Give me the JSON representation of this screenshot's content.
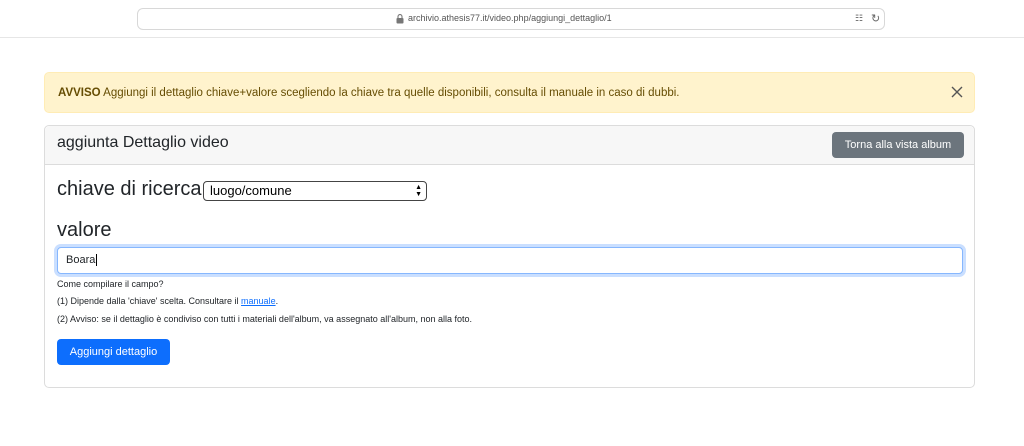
{
  "browser": {
    "url": "archivio.athesis77.it/video.php/aggiungi_dettaglio/1"
  },
  "alert": {
    "strong": "AVVISO",
    "message": "Aggiungi il dettaglio chiave+valore scegliendo la chiave tra quelle disponibili, consulta il manuale in caso di dubbi."
  },
  "card": {
    "title": "aggiunta Dettaglio video",
    "back_button": "Torna alla vista album"
  },
  "form": {
    "key_label": "chiave di ricerca",
    "key_selected": "luogo/comune",
    "value_label": "valore",
    "value_input": "Boara",
    "help_title": "Come compilare il campo?",
    "help_1_prefix": "(1) Dipende dalla 'chiave' scelta. Consultare il",
    "help_1_link": "manuale",
    "help_1_suffix": ".",
    "help_2": "(2) Avviso: se il dettaglio è condiviso con tutti i materiali dell'album, va assegnato all'album, non alla foto.",
    "submit": "Aggiungi dettaglio"
  },
  "colors": {
    "alert_bg": "#fff3cd",
    "alert_text": "#664d03",
    "primary": "#0d6efd",
    "secondary": "#6c757d"
  }
}
